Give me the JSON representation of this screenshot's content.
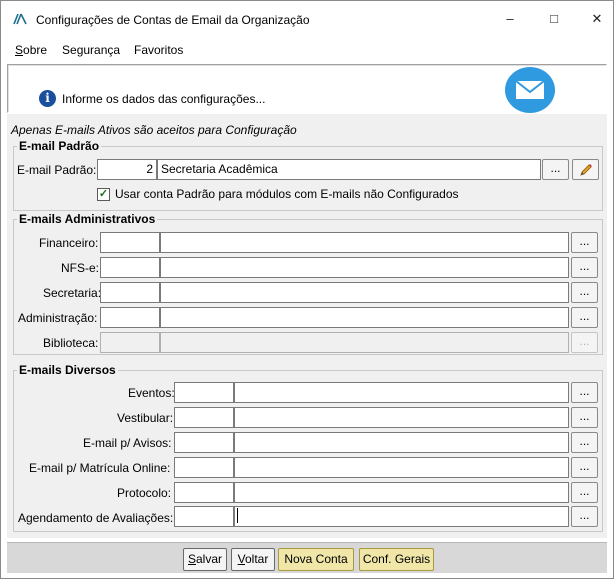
{
  "window": {
    "title": "Configurações de Contas de Email da Organização"
  },
  "menu": [
    {
      "label": "Sobre",
      "key": "S"
    },
    {
      "label": "Segurança",
      "key": "g"
    },
    {
      "label": "Favoritos",
      "key": ""
    }
  ],
  "banner": {
    "text": "Informe os dados das configurações...",
    "info_icon": "info-icon",
    "mail_icon": "envelope-icon"
  },
  "note": "Apenas E-mails Ativos são aceitos para Configuração",
  "email_padrao": {
    "legend": "E-mail Padrão",
    "label": "E-mail Padrão:",
    "code": "2",
    "name": "Secretaria Acadêmica",
    "checkbox_label": "Usar conta Padrão para módulos com E-mails  não Configurados",
    "checkbox_checked": true
  },
  "admin": {
    "legend": "E-mails Administrativos",
    "rows": [
      {
        "label": "Financeiro:",
        "code": "",
        "name": "",
        "enabled": true
      },
      {
        "label": "NFS-e:",
        "code": "",
        "name": "",
        "enabled": true
      },
      {
        "label": "Secretaria:",
        "code": "",
        "name": "",
        "enabled": true
      },
      {
        "label": "Administração:",
        "code": "",
        "name": "",
        "enabled": true
      },
      {
        "label": "Biblioteca:",
        "code": "",
        "name": "",
        "enabled": false
      }
    ]
  },
  "diversos": {
    "legend": "E-mails Diversos",
    "rows": [
      {
        "label": "Eventos:",
        "code": "",
        "name": ""
      },
      {
        "label": "Vestibular:",
        "code": "",
        "name": ""
      },
      {
        "label": "E-mail p/ Avisos:",
        "code": "",
        "name": ""
      },
      {
        "label": "E-mail p/ Matrícula Online:",
        "code": "",
        "name": ""
      },
      {
        "label": "Protocolo:",
        "code": "",
        "name": ""
      },
      {
        "label": "Agendamento de Avaliações:",
        "code": "",
        "name": ""
      }
    ]
  },
  "lookup_button": "...",
  "buttons": {
    "salvar": "Salvar",
    "voltar": "Voltar",
    "nova_conta": "Nova Conta",
    "conf_gerais": "Conf. Gerais"
  },
  "colors": {
    "yellow_button": "#efe6a8",
    "info_blue": "#1a4f9e",
    "mail_blue": "#2f9ae0",
    "panel_gray": "#f0f0f0"
  }
}
